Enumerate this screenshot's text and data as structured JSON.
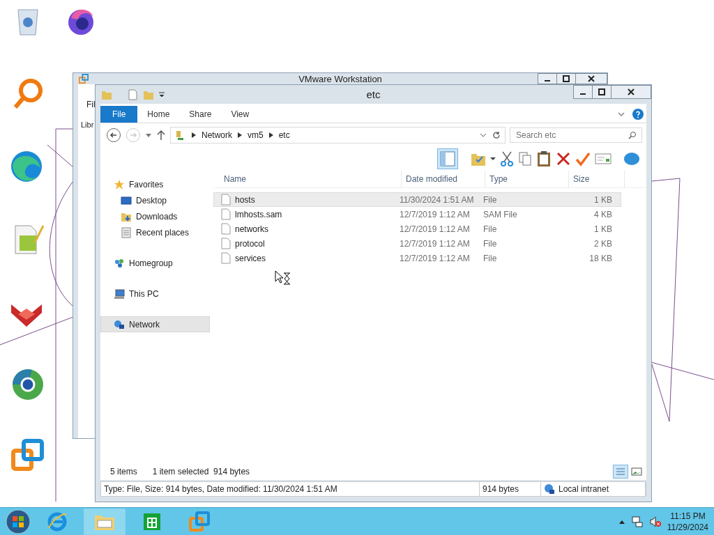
{
  "background_window": {
    "title": "VMware Workstation",
    "menu": "Fil",
    "label": "Libr"
  },
  "window": {
    "title": "etc",
    "ribbon_tabs": [
      {
        "label": "File",
        "kind": "file"
      },
      {
        "label": "Home",
        "kind": "tab"
      },
      {
        "label": "Share",
        "kind": "tab"
      },
      {
        "label": "View",
        "kind": "tab"
      }
    ],
    "address": [
      "Network",
      "vm5",
      "etc"
    ],
    "search": {
      "placeholder": "Search etc"
    },
    "navigation": [
      {
        "label": "Favorites",
        "kind": "favorites",
        "selected": false,
        "children": [
          {
            "label": "Desktop",
            "kind": "desktop",
            "selected": false
          },
          {
            "label": "Downloads",
            "kind": "downloads",
            "selected": false
          },
          {
            "label": "Recent places",
            "kind": "recent",
            "selected": false
          }
        ]
      },
      {
        "label": "Homegroup",
        "kind": "homegroup",
        "selected": false
      },
      {
        "label": "This PC",
        "kind": "pc",
        "selected": false
      },
      {
        "label": "Network",
        "kind": "network",
        "selected": true
      }
    ],
    "table": {
      "columns": [
        "Name",
        "Date modified",
        "Type",
        "Size"
      ],
      "rows": [
        {
          "name": "hosts",
          "date": "11/30/2024 1:51 AM",
          "type": "File",
          "size": "1 KB",
          "selected": true
        },
        {
          "name": "lmhosts.sam",
          "date": "12/7/2019 1:12 AM",
          "type": "SAM File",
          "size": "4 KB",
          "selected": false
        },
        {
          "name": "networks",
          "date": "12/7/2019 1:12 AM",
          "type": "File",
          "size": "1 KB",
          "selected": false
        },
        {
          "name": "protocol",
          "date": "12/7/2019 1:12 AM",
          "type": "File",
          "size": "2 KB",
          "selected": false
        },
        {
          "name": "services",
          "date": "12/7/2019 1:12 AM",
          "type": "File",
          "size": "18 KB",
          "selected": false
        }
      ]
    },
    "status": {
      "items": "5 items",
      "selection": "1 item selected  914 bytes"
    },
    "details_bar": {
      "info": "Type: File, Size: 914 bytes, Date modified: 11/30/2024 1:51 AM",
      "size": "914 bytes",
      "zone": "Local intranet"
    }
  },
  "taskbar": {
    "buttons": [
      {
        "kind": "browser",
        "selected": false
      },
      {
        "kind": "explorer",
        "selected": true
      },
      {
        "kind": "store",
        "selected": false
      },
      {
        "kind": "vmware",
        "selected": false
      }
    ],
    "time": "11:15 PM",
    "date": "11/29/2024"
  }
}
